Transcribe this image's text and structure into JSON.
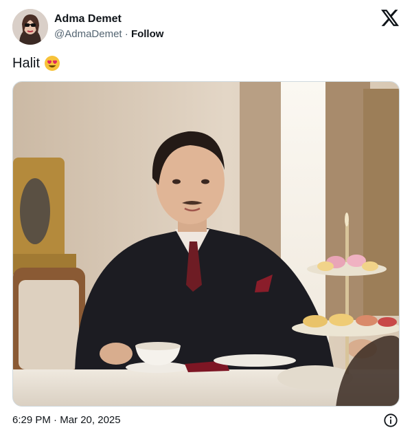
{
  "author": {
    "display_name": "Adma Demet",
    "handle": "@AdmaDemet",
    "separator": "·",
    "follow_label": "Follow"
  },
  "tweet": {
    "text": "Halit",
    "emoji": "heart-eyes-emoji",
    "media_icon": "photo"
  },
  "footer": {
    "time": "6:29 PM",
    "separator": "·",
    "date": "Mar 20, 2025"
  },
  "icons": {
    "logo": "x-logo-icon",
    "info": "info-icon"
  },
  "colors": {
    "text_primary": "#0f1419",
    "text_secondary": "#536471",
    "border": "#cfd9de",
    "emoji_face": "#f7c23a",
    "emoji_heart": "#e0245e"
  }
}
